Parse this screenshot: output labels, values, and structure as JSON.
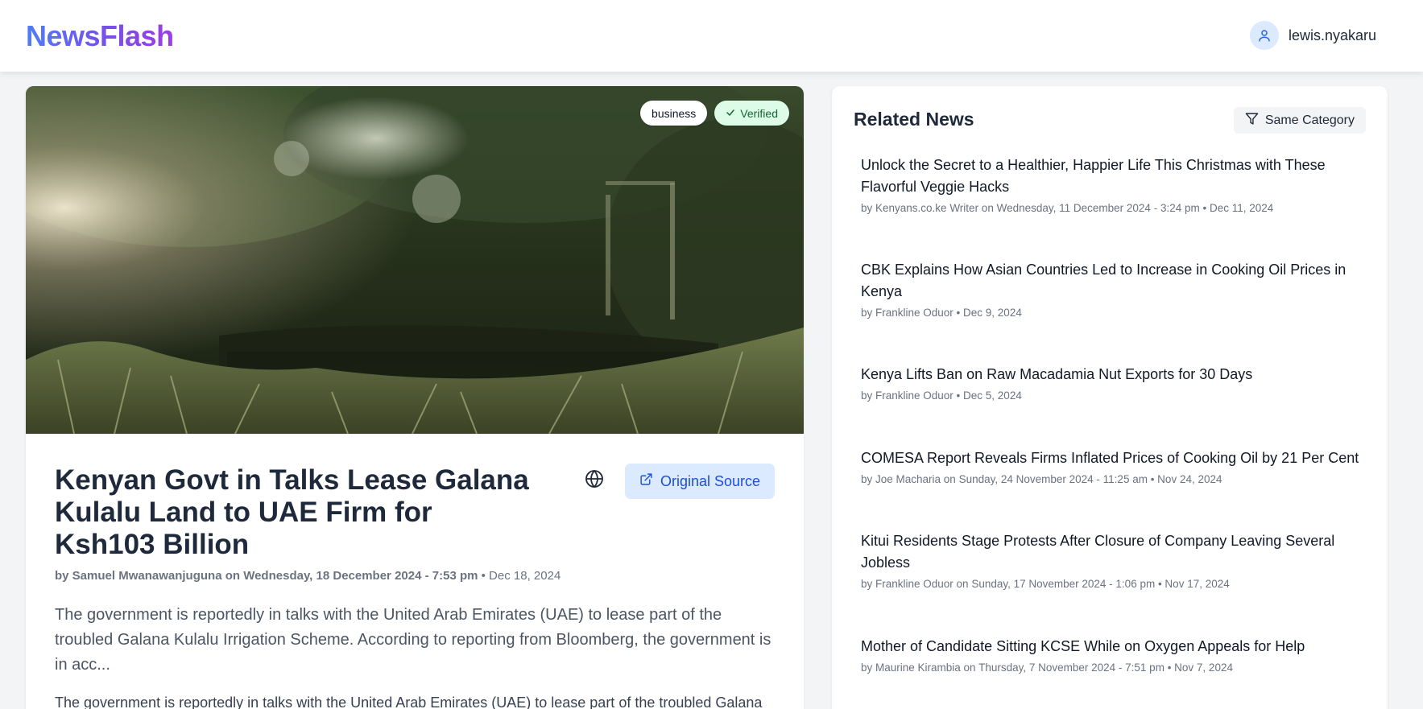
{
  "header": {
    "logo": "NewsFlash",
    "username": "lewis.nyakaru"
  },
  "article": {
    "category_badge": "business",
    "verified_badge": "Verified",
    "title": "Kenyan Govt in Talks Lease Galana Kulalu Land to UAE Firm for Ksh103 Billion",
    "source_button": "Original Source",
    "byline_author": "by Samuel Mwanawanjuguna on Wednesday, 18 December 2024 - 7:53 pm",
    "byline_date": " • Dec 18, 2024",
    "summary": "The government is reportedly in talks with the United Arab Emirates (UAE) to lease part of the troubled Galana Kulalu Irrigation Scheme. According to reporting from Bloomberg, the government is in acc...",
    "body": "The government is reportedly in talks with the United Arab Emirates (UAE) to lease part of the troubled Galana"
  },
  "related": {
    "title": "Related News",
    "filter_label": "Same Category",
    "items": [
      {
        "title": "Unlock the Secret to a Healthier, Happier Life This Christmas with These Flavorful Veggie Hacks",
        "meta": "by Kenyans.co.ke Writer on Wednesday, 11 December 2024 - 3:24 pm • Dec 11, 2024"
      },
      {
        "title": "CBK Explains How Asian Countries Led to Increase in Cooking Oil Prices in Kenya",
        "meta": "by Frankline Oduor • Dec 9, 2024"
      },
      {
        "title": "Kenya Lifts Ban on Raw Macadamia Nut Exports for 30 Days",
        "meta": "by Frankline Oduor • Dec 5, 2024"
      },
      {
        "title": "COMESA Report Reveals Firms Inflated Prices of Cooking Oil by 21 Per Cent",
        "meta": "by Joe Macharia on Sunday, 24 November 2024 - 11:25 am • Nov 24, 2024"
      },
      {
        "title": "Kitui Residents Stage Protests After Closure of Company Leaving Several Jobless",
        "meta": "by Frankline Oduor on Sunday, 17 November 2024 - 1:06 pm • Nov 17, 2024"
      },
      {
        "title": "Mother of Candidate Sitting KCSE While on Oxygen Appeals for Help",
        "meta": "by Maurine Kirambia on Thursday, 7 November 2024 - 7:51 pm • Nov 7, 2024"
      }
    ]
  },
  "icons": {
    "user": "user-icon",
    "check": "check-icon",
    "globe": "globe-icon",
    "external_link": "external-link-icon",
    "filter": "filter-icon"
  },
  "colors": {
    "logo_gradient_start": "#4f7df5",
    "logo_gradient_end": "#9b3ee6",
    "accent_blue": "#1d4ed8",
    "verified_green": "#166534"
  }
}
